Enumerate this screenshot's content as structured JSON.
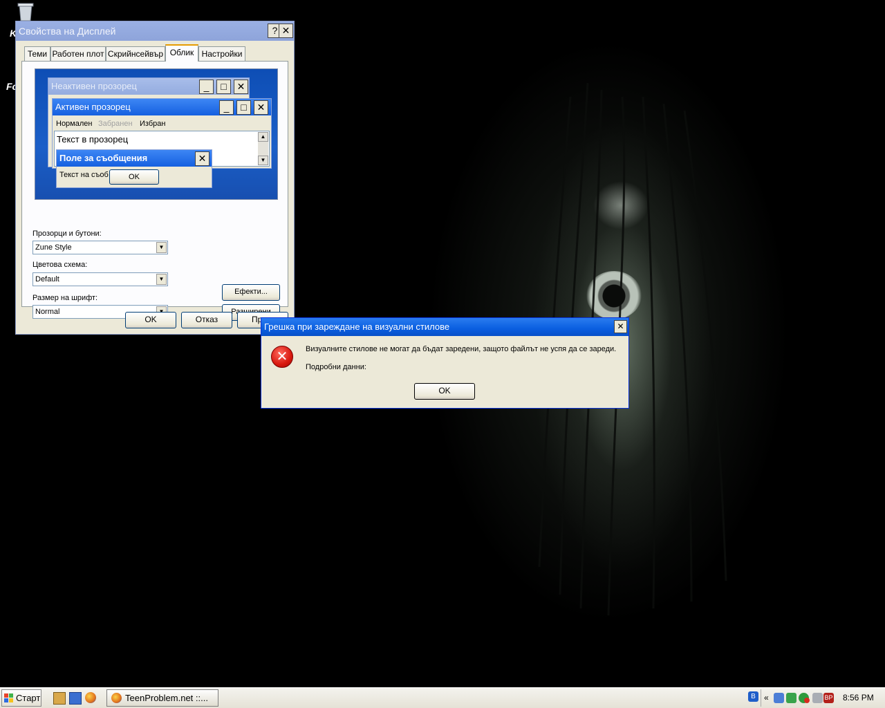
{
  "desktop": {
    "icon_labels": [
      "K",
      "Fo"
    ]
  },
  "display_properties": {
    "title": "Свойства на Дисплей",
    "help_button": "?",
    "close_button": "✕",
    "tabs": [
      {
        "label": "Теми",
        "active": false
      },
      {
        "label": "Работен плот",
        "active": false
      },
      {
        "label": "Скрийнсейвър",
        "active": false
      },
      {
        "label": "Облик",
        "active": true
      },
      {
        "label": "Настройки",
        "active": false
      }
    ],
    "preview": {
      "inactive_title": "Неактивен прозорец",
      "active_title": "Активен прозорец",
      "menu_normal": "Нормален",
      "menu_disabled": "Забранен",
      "menu_selected": "Избран",
      "window_text": "Текст в прозорец",
      "msgbox_title": "Поле за съобщения",
      "msgbox_text": "Текст на съоб",
      "msgbox_ok": "OK"
    },
    "windows_buttons_label": "Прозорци и бутони:",
    "windows_buttons_value": "Zune Style",
    "color_scheme_label": "Цветова схема:",
    "color_scheme_value": "Default",
    "font_size_label": "Размер на шрифт:",
    "font_size_value": "Normal",
    "effects_button": "Ефекти...",
    "advanced_button": "Разширени",
    "ok_button": "OK",
    "cancel_button": "Отказ",
    "apply_button": "При..."
  },
  "error_dialog": {
    "title": "Грешка при зареждане на визуални стилове",
    "close_button": "✕",
    "message": "Визуалните стилове не могат да бъдат заредени, защото файлът не успя да се зареди.",
    "details_label": "Подробни данни:",
    "ok_button": "OK",
    "icon": "error-icon"
  },
  "taskbar": {
    "start_label": "Старт",
    "task_label": "TeenProblem.net ::...",
    "tray_chevron": "«",
    "tray_badge": "BP",
    "clock": "8:56 PM"
  }
}
